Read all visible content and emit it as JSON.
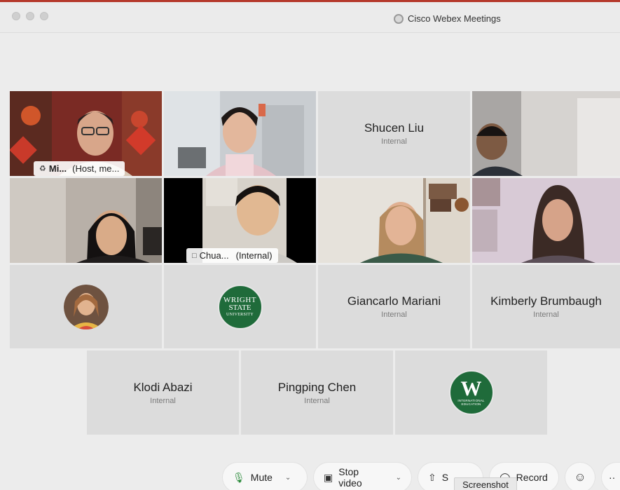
{
  "window": {
    "title": "Cisco Webex Meetings"
  },
  "participants": {
    "mi": {
      "label": "Mi...",
      "suffix": "(Host, me..."
    },
    "shucen": {
      "name": "Shucen Liu",
      "role": "Internal"
    },
    "chua": {
      "label": "Chua...",
      "suffix": "(Internal)"
    },
    "giancarlo": {
      "name": "Giancarlo Mariani",
      "role": "Internal"
    },
    "kimberly": {
      "name": "Kimberly Brumbaugh",
      "role": "Internal"
    },
    "klodi": {
      "name": "Klodi Abazi",
      "role": "Internal"
    },
    "pingping": {
      "name": "Pingping Chen",
      "role": "Internal"
    },
    "wright_logo": {
      "l1": "WRIGHT",
      "l2": "STATE",
      "l3": "UNIVERSITY"
    },
    "w_logo": {
      "letter": "W",
      "sub1": "INTERNATIONAL",
      "sub2": "EDUCATION"
    }
  },
  "controls": {
    "mute": "Mute",
    "stop_video": "Stop video",
    "share": "S",
    "record": "Record",
    "more": "··"
  },
  "tooltip": "Screenshot",
  "colors": {
    "accent_top": "#b5392b",
    "wright_green": "#1f6b3a"
  }
}
